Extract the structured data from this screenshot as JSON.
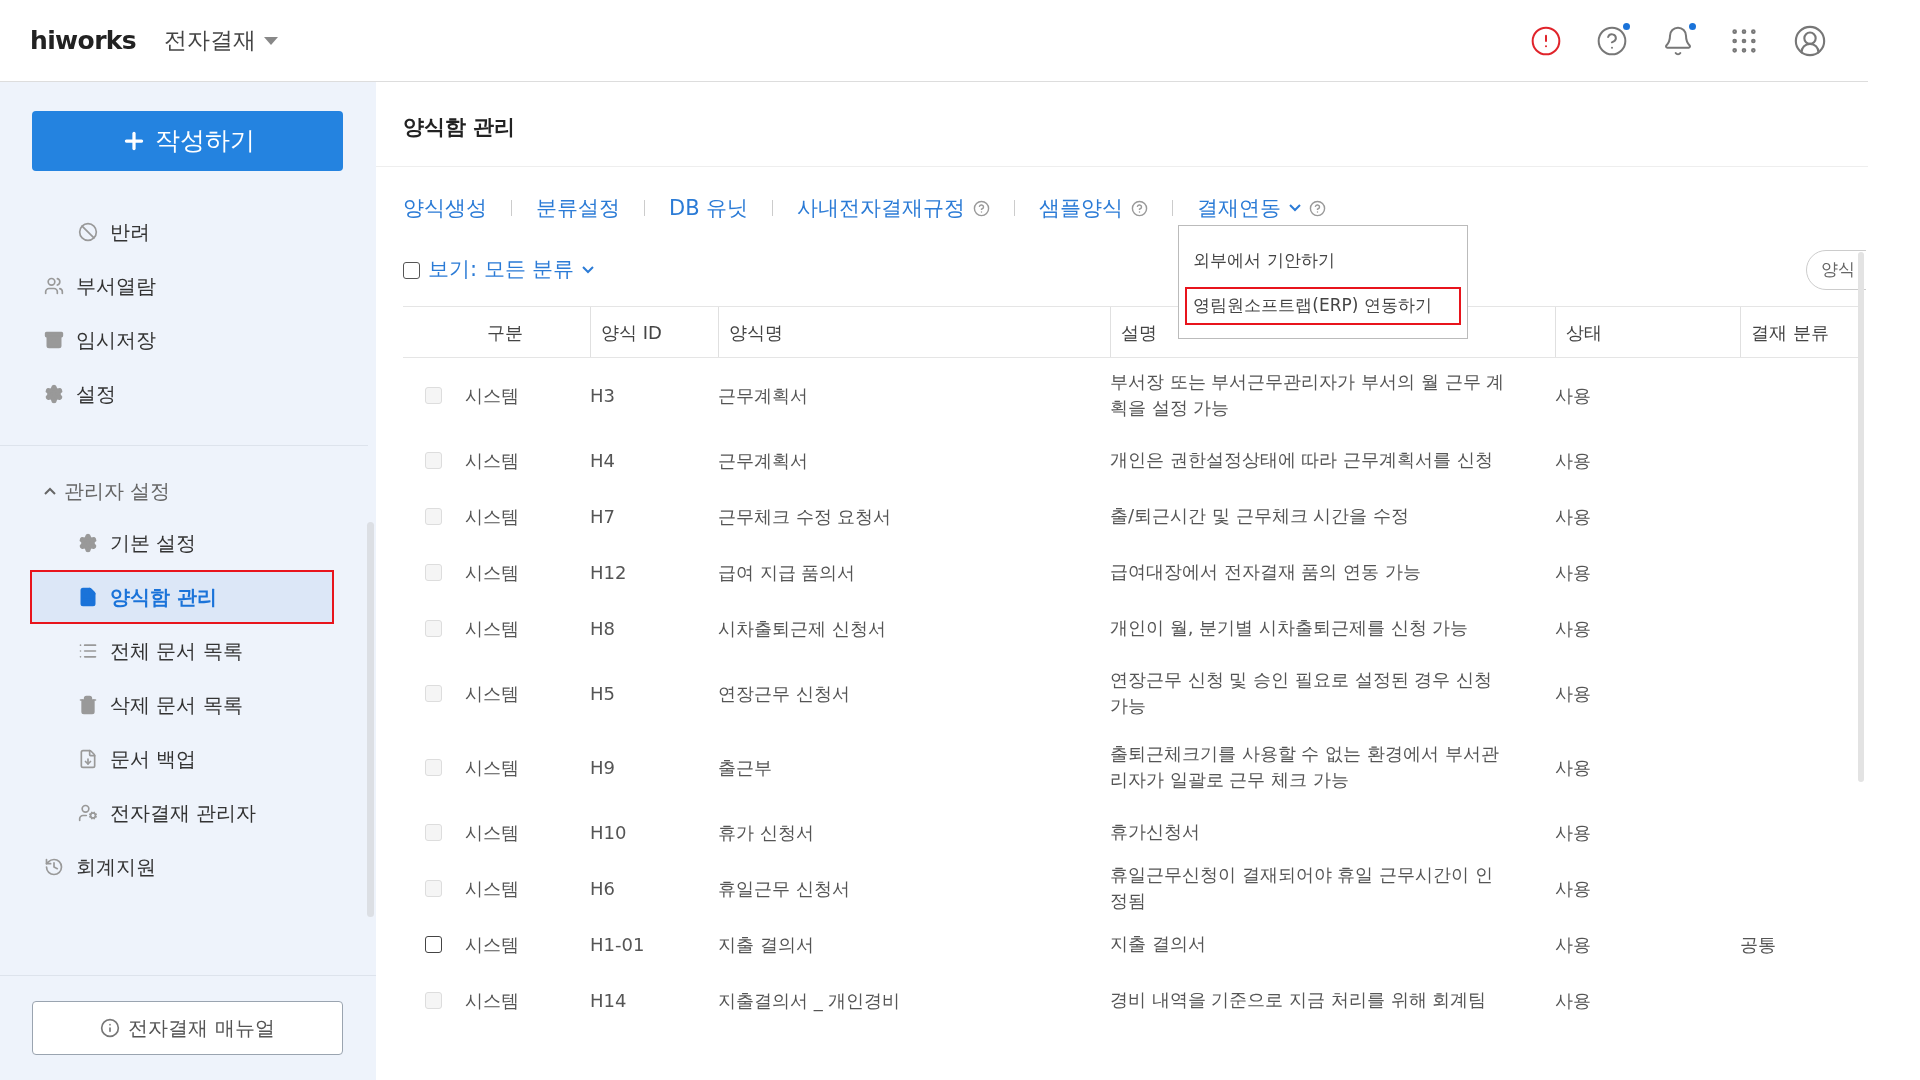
{
  "topbar": {
    "logo": "hiworks",
    "app": "전자결재",
    "icons": [
      {
        "kind": "alert",
        "badge": false
      },
      {
        "kind": "help",
        "badge": true
      },
      {
        "kind": "bell",
        "badge": true
      },
      {
        "kind": "apps",
        "badge": false
      },
      {
        "kind": "avatar",
        "badge": false
      }
    ]
  },
  "sidebar": {
    "compose": "작성하기",
    "items": [
      {
        "label": "반려",
        "selected": false,
        "annotated": false
      },
      {
        "label": "부서열람",
        "selected": false,
        "annotated": false
      },
      {
        "label": "임시저장",
        "selected": false,
        "annotated": false
      },
      {
        "label": "설정",
        "selected": false,
        "annotated": false
      }
    ],
    "admin": {
      "label": "관리자 설정",
      "expanded": true,
      "children": [
        {
          "label": "기본 설정",
          "selected": false,
          "annotated": false
        },
        {
          "label": "양식함 관리",
          "selected": true,
          "annotated": true
        },
        {
          "label": "전체 문서 목록",
          "selected": false,
          "annotated": false
        },
        {
          "label": "삭제 문서 목록",
          "selected": false,
          "annotated": false
        },
        {
          "label": "문서 백업",
          "selected": false,
          "annotated": false
        },
        {
          "label": "전자결재 관리자",
          "selected": false,
          "annotated": false
        }
      ]
    },
    "extra": [
      {
        "label": "회계지원",
        "selected": false,
        "annotated": false
      }
    ],
    "manual": "전자결재 매뉴얼"
  },
  "page": {
    "title": "양식함 관리",
    "tabs": [
      {
        "label": "양식생성",
        "kind": "plain"
      },
      {
        "label": "분류설정",
        "kind": "plain"
      },
      {
        "label": "DB 유닛",
        "kind": "plain"
      },
      {
        "label": "사내전자결재규정",
        "kind": "help"
      },
      {
        "label": "샘플양식",
        "kind": "help"
      },
      {
        "label": "결재연동",
        "kind": "menu",
        "expanded": true
      }
    ],
    "dropdown": [
      {
        "label": "외부에서 기안하기",
        "annotated": false
      },
      {
        "label": "영림원소프트랩(ERP) 연동하기",
        "annotated": true
      }
    ],
    "filter": {
      "checked": false,
      "label": "보기: 모든 분류"
    },
    "search_button": "양식",
    "table": {
      "columns": [
        "구분",
        "양식 ID",
        "양식명",
        "설명",
        "상태",
        "결재 분류"
      ],
      "rows": [
        {
          "disabled": true,
          "type": "시스템",
          "id": "H3",
          "name": "근무계획서",
          "description": "부서장 또는 부서근무관리자가 부서의 월 근무 계획을 설정 가능",
          "status": "사용"
        },
        {
          "disabled": true,
          "type": "시스템",
          "id": "H4",
          "name": "근무계획서",
          "description": "개인은 권한설정상태에 따라 근무계획서를 신청",
          "status": "사용"
        },
        {
          "disabled": true,
          "type": "시스템",
          "id": "H7",
          "name": "근무체크 수정 요청서",
          "description": "출/퇴근시간 및 근무체크 시간을 수정",
          "status": "사용"
        },
        {
          "disabled": true,
          "type": "시스템",
          "id": "H12",
          "name": "급여 지급 품의서",
          "description": "급여대장에서 전자결재 품의 연동 가능",
          "status": "사용"
        },
        {
          "disabled": true,
          "type": "시스템",
          "id": "H8",
          "name": "시차출퇴근제 신청서",
          "description": "개인이 월, 분기별 시차출퇴근제를 신청 가능",
          "status": "사용"
        },
        {
          "disabled": true,
          "type": "시스템",
          "id": "H5",
          "name": "연장근무 신청서",
          "description": "연장근무 신청 및 승인 필요로 설정된 경우 신청 가능",
          "status": "사용"
        },
        {
          "disabled": true,
          "type": "시스템",
          "id": "H9",
          "name": "출근부",
          "description": "출퇴근체크기를 사용할 수 없는 환경에서 부서관리자가 일괄로 근무 체크 가능",
          "status": "사용"
        },
        {
          "disabled": true,
          "type": "시스템",
          "id": "H10",
          "name": "휴가 신청서",
          "description": "휴가신청서",
          "status": "사용"
        },
        {
          "disabled": true,
          "type": "시스템",
          "id": "H6",
          "name": "휴일근무 신청서",
          "description": "휴일근무신청이 결재되어야 휴일 근무시간이 인정됨",
          "status": "사용"
        },
        {
          "disabled": false,
          "type": "시스템",
          "id": "H1-01",
          "name": "지출 결의서",
          "description": "지출 결의서",
          "status": "사용",
          "category": "공통"
        },
        {
          "disabled": true,
          "type": "시스템",
          "id": "H14",
          "name": "지출결의서 _ 개인경비",
          "description": "경비 내역을 기준으로 지금 처리를 위해 회계팀",
          "status": "사용"
        }
      ]
    }
  }
}
